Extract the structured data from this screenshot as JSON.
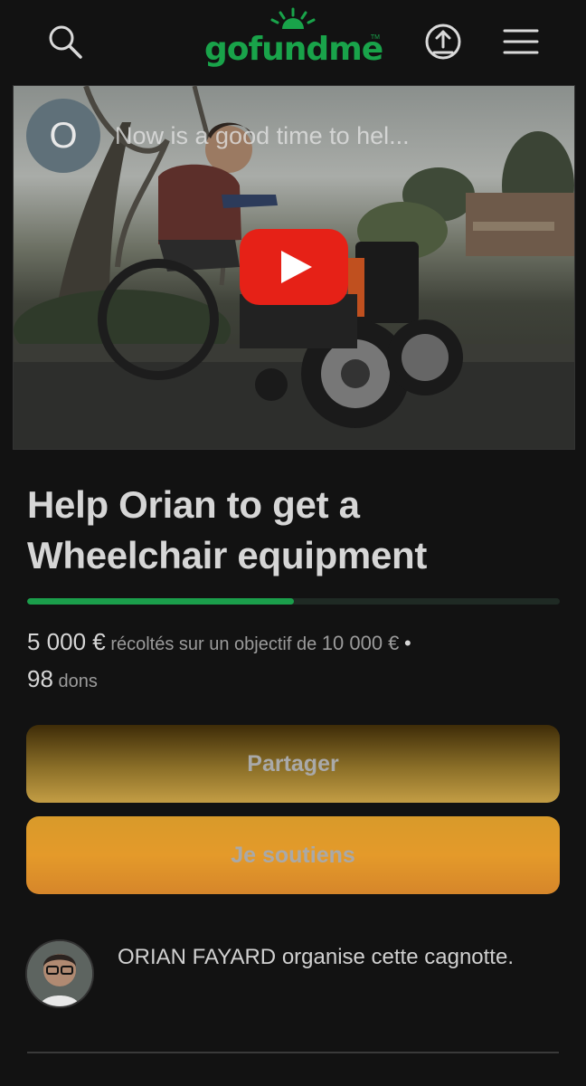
{
  "header": {
    "logo_text": "gofundme",
    "logo_tm": "TM",
    "brand_color": "#19a34a",
    "icons": [
      "search-icon",
      "share-upload-icon",
      "menu-icon"
    ]
  },
  "video": {
    "channel_initial": "O",
    "title": "Now is a good time to hel...",
    "play_icon": "youtube-play-icon"
  },
  "campaign": {
    "title": "Help Orian to get a Wheelchair equipment",
    "progress_fraction": 0.5,
    "raised": "5 000 €",
    "raised_suffix": "récoltés sur un objectif de",
    "goal": "10 000 €",
    "separator": "•",
    "donations_count": "98",
    "donations_label": "dons"
  },
  "actions": {
    "share_label": "Partager",
    "donate_label": "Je soutiens"
  },
  "organizer": {
    "name": "ORIAN FAYARD",
    "text": "organise cette cagnotte."
  }
}
